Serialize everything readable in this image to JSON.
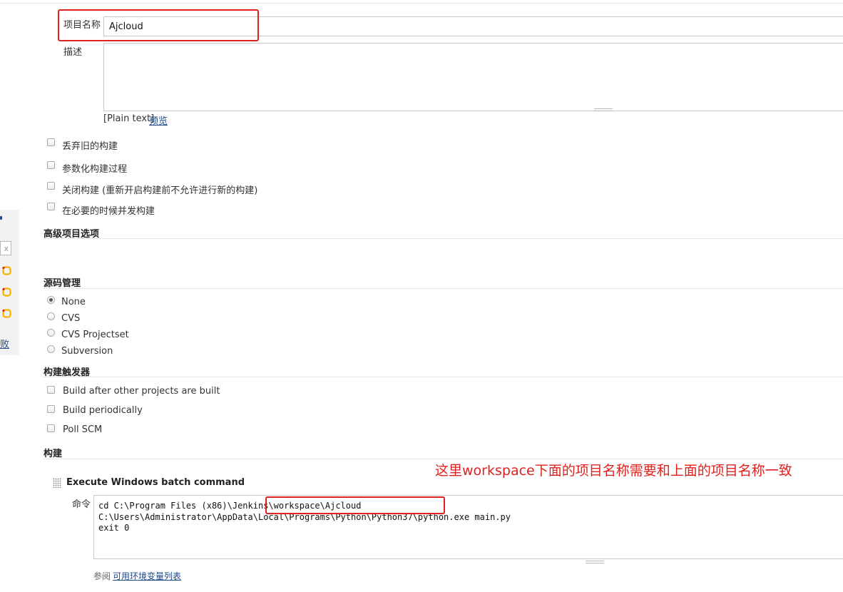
{
  "project": {
    "name_label": "项目名称",
    "name_value": "Ajcloud",
    "description_label": "描述",
    "description_value": "",
    "format_text": "[Plain text]",
    "preview_link": "预览"
  },
  "options": [
    {
      "label": "丢弃旧的构建",
      "checked": false
    },
    {
      "label": "参数化构建过程",
      "checked": false
    },
    {
      "label": "关闭构建 (重新开启构建前不允许进行新的构建)",
      "checked": false
    },
    {
      "label": "在必要的时候并发构建",
      "checked": false
    }
  ],
  "sections": {
    "advanced": "高级项目选项",
    "scm": "源码管理",
    "triggers": "构建触发器",
    "build": "构建"
  },
  "scm_options": [
    {
      "label": "None",
      "selected": true
    },
    {
      "label": "CVS",
      "selected": false
    },
    {
      "label": "CVS Projectset",
      "selected": false
    },
    {
      "label": "Subversion",
      "selected": false
    }
  ],
  "triggers": [
    {
      "label": "Build after other projects are built",
      "checked": false
    },
    {
      "label": "Build periodically",
      "checked": false
    },
    {
      "label": "Poll SCM",
      "checked": false
    }
  ],
  "build_step": {
    "title": "Execute Windows batch command",
    "command_label": "命令",
    "command_value": "cd C:\\Program Files (x86)\\Jenkins\\workspace\\Ajcloud\nC:\\Users\\Administrator\\AppData\\Local\\Programs\\Python\\Python37\\python.exe main.py\nexit 0",
    "env_prefix": "参阅",
    "env_link": "可用环境变量列表"
  },
  "annotation": "这里workspace下面的项目名称需要和上面的项目名称一致",
  "sidebar": {
    "clear_label": "x",
    "partial_link": "败"
  },
  "colors": {
    "annotation_red": "#e0211f",
    "link_blue": "#204a87"
  },
  "icons": [
    "jenkins-status-icon",
    "jenkins-status-icon",
    "jenkins-status-icon"
  ]
}
